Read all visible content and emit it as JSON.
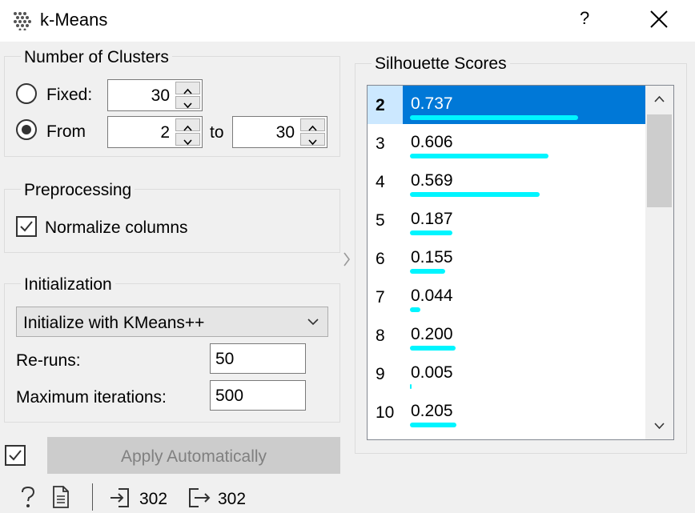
{
  "window": {
    "title": "k-Means",
    "help_glyph": "?",
    "icons": {
      "app": "kmeans-dots-icon",
      "close": "close-icon"
    }
  },
  "clusters": {
    "title": "Number of Clusters",
    "fixed_label": "Fixed:",
    "fixed_value": "30",
    "from_label": "From",
    "from_value": "2",
    "to_label": "to",
    "to_value": "30",
    "selected_mode": "From"
  },
  "preprocessing": {
    "title": "Preprocessing",
    "normalize_label": "Normalize columns",
    "normalize_checked": true
  },
  "initialization": {
    "title": "Initialization",
    "method": "Initialize with KMeans++",
    "reruns_label": "Re-runs:",
    "reruns_value": "50",
    "maxiter_label": "Maximum iterations:",
    "maxiter_value": "500"
  },
  "silhouette": {
    "title": "Silhouette Scores",
    "selected_k": "2",
    "rows": [
      {
        "k": "2",
        "score": "0.737",
        "value": 0.737
      },
      {
        "k": "3",
        "score": "0.606",
        "value": 0.606
      },
      {
        "k": "4",
        "score": "0.569",
        "value": 0.569
      },
      {
        "k": "5",
        "score": "0.187",
        "value": 0.187
      },
      {
        "k": "6",
        "score": "0.155",
        "value": 0.155
      },
      {
        "k": "7",
        "score": "0.044",
        "value": 0.044
      },
      {
        "k": "8",
        "score": "0.200",
        "value": 0.2
      },
      {
        "k": "9",
        "score": "0.005",
        "value": 0.005
      },
      {
        "k": "10",
        "score": "0.205",
        "value": 0.205
      }
    ],
    "bar_color": "#00f5ff",
    "selection_color": "#0078d7"
  },
  "footer": {
    "apply_checked": true,
    "apply_label": "Apply Automatically",
    "input_count": "302",
    "output_count": "302",
    "icons": {
      "help": "help-icon",
      "report": "report-icon",
      "input": "input-icon",
      "output": "output-icon"
    }
  }
}
